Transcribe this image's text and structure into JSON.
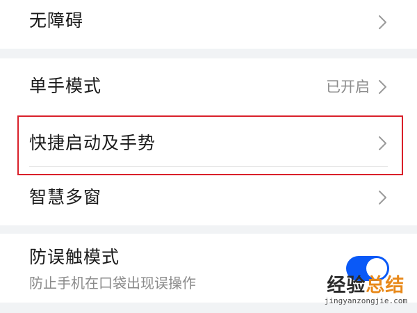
{
  "settings": {
    "accessibility": {
      "label": "无障碍",
      "chevron_icon": "chevron-right-icon"
    },
    "one_handed_mode": {
      "label": "单手模式",
      "value": "已开启",
      "chevron_icon": "chevron-right-icon"
    },
    "shortcuts_gestures": {
      "label": "快捷启动及手势",
      "chevron_icon": "chevron-right-icon",
      "highlighted": true
    },
    "smart_multiwindow": {
      "label": "智慧多窗",
      "chevron_icon": "chevron-right-icon"
    },
    "accidental_touch": {
      "label": "防误触模式",
      "description": "防止手机在口袋出现误操作",
      "toggle_on": true
    }
  },
  "watermark": {
    "text_dark": "经验",
    "text_accent": "总结",
    "url": "jingyanzongjie.com"
  },
  "colors": {
    "background": "#f1f3f5",
    "card": "#ffffff",
    "toggle_on": "#0a59f7",
    "highlight_border": "#d9202a",
    "watermark_accent": "#e8891a"
  }
}
